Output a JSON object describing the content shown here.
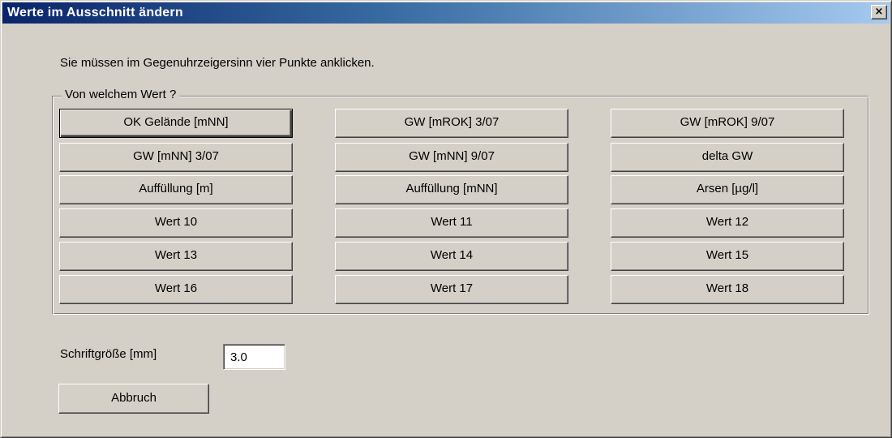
{
  "window": {
    "title": "Werte im Ausschnitt ändern",
    "close_label": "×"
  },
  "instruction": "Sie müssen im Gegenuhrzeigersinn vier Punkte anklicken.",
  "group": {
    "legend": "Von welchem Wert ?",
    "buttons": [
      "OK Gelände [mNN]",
      "GW [mROK] 3/07",
      "GW [mROK] 9/07",
      "GW [mNN] 3/07",
      "GW [mNN] 9/07",
      "delta GW",
      "Auffüllung [m]",
      "Auffüllung [mNN]",
      "Arsen [µg/l]",
      "Wert 10",
      "Wert 11",
      "Wert 12",
      "Wert 13",
      "Wert 14",
      "Wert 15",
      "Wert 16",
      "Wert 17",
      "Wert 18"
    ]
  },
  "font_size": {
    "label": "Schriftgröße [mm]",
    "value": "3.0"
  },
  "cancel_label": "Abbruch"
}
